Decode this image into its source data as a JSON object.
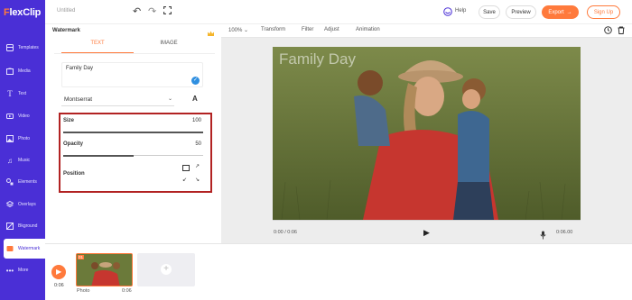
{
  "app": {
    "logo_first": "F",
    "logo_rest": "lexClip",
    "doc_title": "Untitled"
  },
  "topbar": {
    "help": "Help",
    "save": "Save",
    "preview": "Preview",
    "export": "Export",
    "signup": "Sign Up"
  },
  "sidebar": {
    "items": [
      {
        "label": "Templates",
        "icon": "templates-icon"
      },
      {
        "label": "Media",
        "icon": "media-icon"
      },
      {
        "label": "Text",
        "icon": "text-icon"
      },
      {
        "label": "Video",
        "icon": "video-icon"
      },
      {
        "label": "Photo",
        "icon": "photo-icon"
      },
      {
        "label": "Music",
        "icon": "music-icon"
      },
      {
        "label": "Elements",
        "icon": "elements-icon"
      },
      {
        "label": "Overlays",
        "icon": "overlays-icon"
      },
      {
        "label": "Bkground",
        "icon": "background-icon"
      },
      {
        "label": "Watermark",
        "icon": "watermark-icon"
      },
      {
        "label": "More",
        "icon": "more-icon"
      }
    ]
  },
  "panel": {
    "title": "Watermark",
    "tabs": [
      "TEXT",
      "IMAGE"
    ],
    "text_value": "Family Day",
    "font": "Montserrat",
    "size_label": "Size",
    "size_value": "100",
    "opacity_label": "Opacity",
    "opacity_value": "50",
    "position_label": "Position",
    "size_fraction": 1.0,
    "opacity_fraction": 0.5
  },
  "stage_tools": {
    "zoom": "100%",
    "transform": "Transform",
    "filter": "Filter",
    "adjust": "Adjust",
    "animation": "Animation"
  },
  "canvas": {
    "watermark_text": "Family Day"
  },
  "player": {
    "current": "0:00 / 0:06",
    "end": "0:06.00"
  },
  "timeline": {
    "time": "0:06",
    "clip_number": "01",
    "clip_label": "Photo",
    "clip_duration": "0:06"
  },
  "colors": {
    "brand": "#4a2fd6",
    "accent": "#ff7a3c",
    "highlight_border": "#b22222"
  }
}
